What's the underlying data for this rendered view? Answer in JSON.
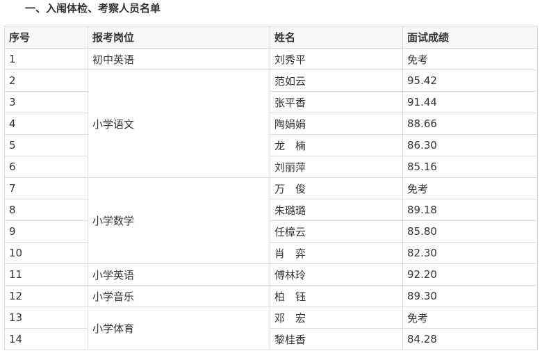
{
  "title": "一、入闱体检、考察人员名单",
  "table": {
    "headers": [
      "序号",
      "报考岗位",
      "姓名",
      "面试成绩"
    ],
    "rows": [
      {
        "no": "1",
        "post": "初中英语",
        "post_span": 1,
        "name": "刘秀平",
        "score": "免考"
      },
      {
        "no": "2",
        "post": "小学语文",
        "post_span": 5,
        "name": "范如云",
        "score": "95.42"
      },
      {
        "no": "3",
        "post": null,
        "post_span": 0,
        "name": "张平香",
        "score": "91.44"
      },
      {
        "no": "4",
        "post": null,
        "post_span": 0,
        "name": "陶娟娟",
        "score": "88.66"
      },
      {
        "no": "5",
        "post": null,
        "post_span": 0,
        "name": "龙　楠",
        "score": "86.30"
      },
      {
        "no": "6",
        "post": null,
        "post_span": 0,
        "name": "刘丽萍",
        "score": "85.16"
      },
      {
        "no": "7",
        "post": "小学数学",
        "post_span": 4,
        "name": "万　俊",
        "score": "免考"
      },
      {
        "no": "8",
        "post": null,
        "post_span": 0,
        "name": "朱璐璐",
        "score": "89.18"
      },
      {
        "no": "9",
        "post": null,
        "post_span": 0,
        "name": "任樟云",
        "score": "85.80"
      },
      {
        "no": "10",
        "post": null,
        "post_span": 0,
        "name": "肖　弈",
        "score": "82.30"
      },
      {
        "no": "11",
        "post": "小学英语",
        "post_span": 1,
        "name": "傅林玲",
        "score": "92.20"
      },
      {
        "no": "12",
        "post": "小学音乐",
        "post_span": 1,
        "name": "柏　钰",
        "score": "89.30"
      },
      {
        "no": "13",
        "post": "小学体育",
        "post_span": 2,
        "name": "邓　宏",
        "score": "免考"
      },
      {
        "no": "14",
        "post": null,
        "post_span": 0,
        "name": "黎桂香",
        "score": "84.28"
      }
    ]
  }
}
